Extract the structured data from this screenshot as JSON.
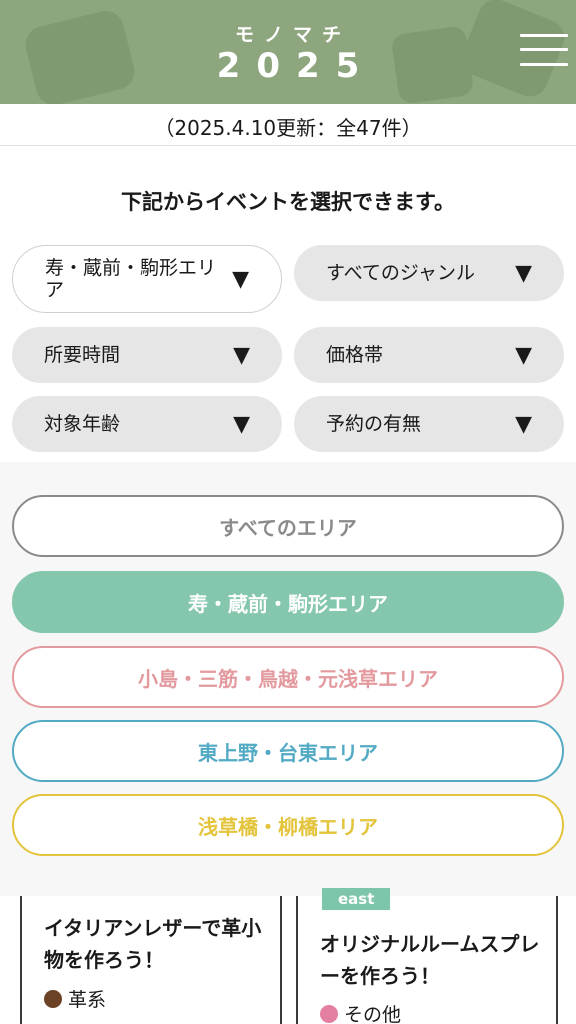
{
  "header": {
    "logo_top": "モノマチ",
    "logo_year": "2025",
    "menu_icon": "hamburger-menu-icon",
    "colors": {
      "background": "#8ea67e",
      "text": "#ffffff"
    }
  },
  "update_text": "（2025.4.10更新：全47件）",
  "instruction": "下記からイベントを選択できます。",
  "filters": [
    {
      "label": "寿・蔵前・駒形エリア",
      "arrow": "▼",
      "active": true
    },
    {
      "label": "すべてのジャンル",
      "arrow": "▼",
      "active": false
    },
    {
      "label": "所要時間",
      "arrow": "▼",
      "active": false
    },
    {
      "label": "価格帯",
      "arrow": "▼",
      "active": false
    },
    {
      "label": "対象年齢",
      "arrow": "▼",
      "active": false
    },
    {
      "label": "予約の有無",
      "arrow": "▼",
      "active": false
    }
  ],
  "areas": [
    {
      "label": "すべてのエリア",
      "color": "#8a8a8a",
      "selected": false
    },
    {
      "label": "寿・蔵前・駒形エリア",
      "color": "#84c7ad",
      "selected": true
    },
    {
      "label": "小島・三筋・鳥越・元浅草エリア",
      "color": "#e39a9e",
      "selected": false
    },
    {
      "label": "東上野・台東エリア",
      "color": "#52aac4",
      "selected": false
    },
    {
      "label": "浅草橋・柳橋エリア",
      "color": "#e3c43c",
      "selected": false
    }
  ],
  "cards": [
    {
      "tag": "",
      "title": "イタリアンレザーで革小物を作ろう！",
      "genre": "革系",
      "genre_color": "#6b4226"
    },
    {
      "tag": "east",
      "title": "オリジナルルームスプレーを作ろう！",
      "genre": "その他",
      "genre_color": "#e37fa0"
    }
  ]
}
